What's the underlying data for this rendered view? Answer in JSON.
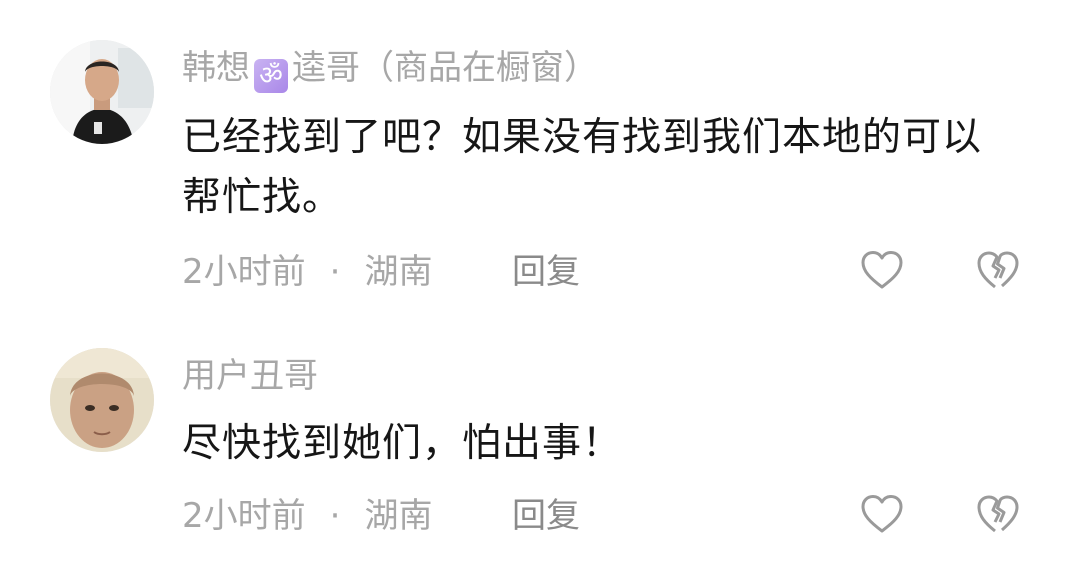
{
  "comments": [
    {
      "username": "韩想",
      "badge_icon": "om-symbol-icon",
      "badge_glyph": "ॐ",
      "username_suffix": "逵哥（商品在橱窗）",
      "content": "已经找到了吧？如果没有找到我们本地的可以帮忙找。",
      "time": "2小时前",
      "separator": "·",
      "location": "湖南",
      "reply_label": "回复",
      "like_icon": "heart-outline-icon",
      "dislike_icon": "broken-heart-icon"
    },
    {
      "username": "用户丑哥",
      "content": "尽快找到她们，怕出事！",
      "time": "2小时前",
      "separator": "·",
      "location": "湖南",
      "reply_label": "回复",
      "like_icon": "heart-outline-icon",
      "dislike_icon": "broken-heart-icon"
    }
  ],
  "colors": {
    "username": "#a7a7a7",
    "content": "#161616",
    "meta": "#a7a7a7",
    "reply": "#8a8a8a",
    "icon_stroke": "#9a9a9a",
    "badge": "#b79cec"
  }
}
